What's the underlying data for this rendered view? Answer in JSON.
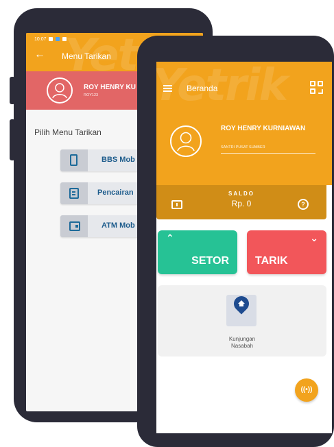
{
  "back_screen": {
    "status_bar": {
      "time": "10:07"
    },
    "header": {
      "title": "Menu Tarikan",
      "watermark": "Yetrik"
    },
    "user": {
      "name": "ROY HENRY KU",
      "id": "ROY123"
    },
    "menu_heading": "Pilih Menu Tarikan",
    "menu_items": [
      {
        "label": "BBS Mob",
        "icon": "phone-icon"
      },
      {
        "label": "Pencairan",
        "icon": "document-icon"
      },
      {
        "label": "ATM Mob",
        "icon": "wallet-icon"
      }
    ]
  },
  "front_screen": {
    "header": {
      "title": "Beranda",
      "watermark": "Yetrik"
    },
    "user": {
      "name": "ROY HENRY KURNIAWAN",
      "subtitle": "SANTRI PUSAT SUMBER"
    },
    "saldo": {
      "label": "SALDO",
      "value": "Rp. 0"
    },
    "actions": {
      "setor_label": "SETOR",
      "tarik_label": "TARIK"
    },
    "kunjungan": {
      "label_line1": "Kunjungan",
      "label_line2": "Nasabah"
    }
  },
  "colors": {
    "primary_orange": "#f2a31d",
    "user_red": "#e26666",
    "setor_green": "#26c295",
    "tarik_red": "#f2565a",
    "menu_blue": "#1d5c8c",
    "frame": "#2b2b38"
  }
}
